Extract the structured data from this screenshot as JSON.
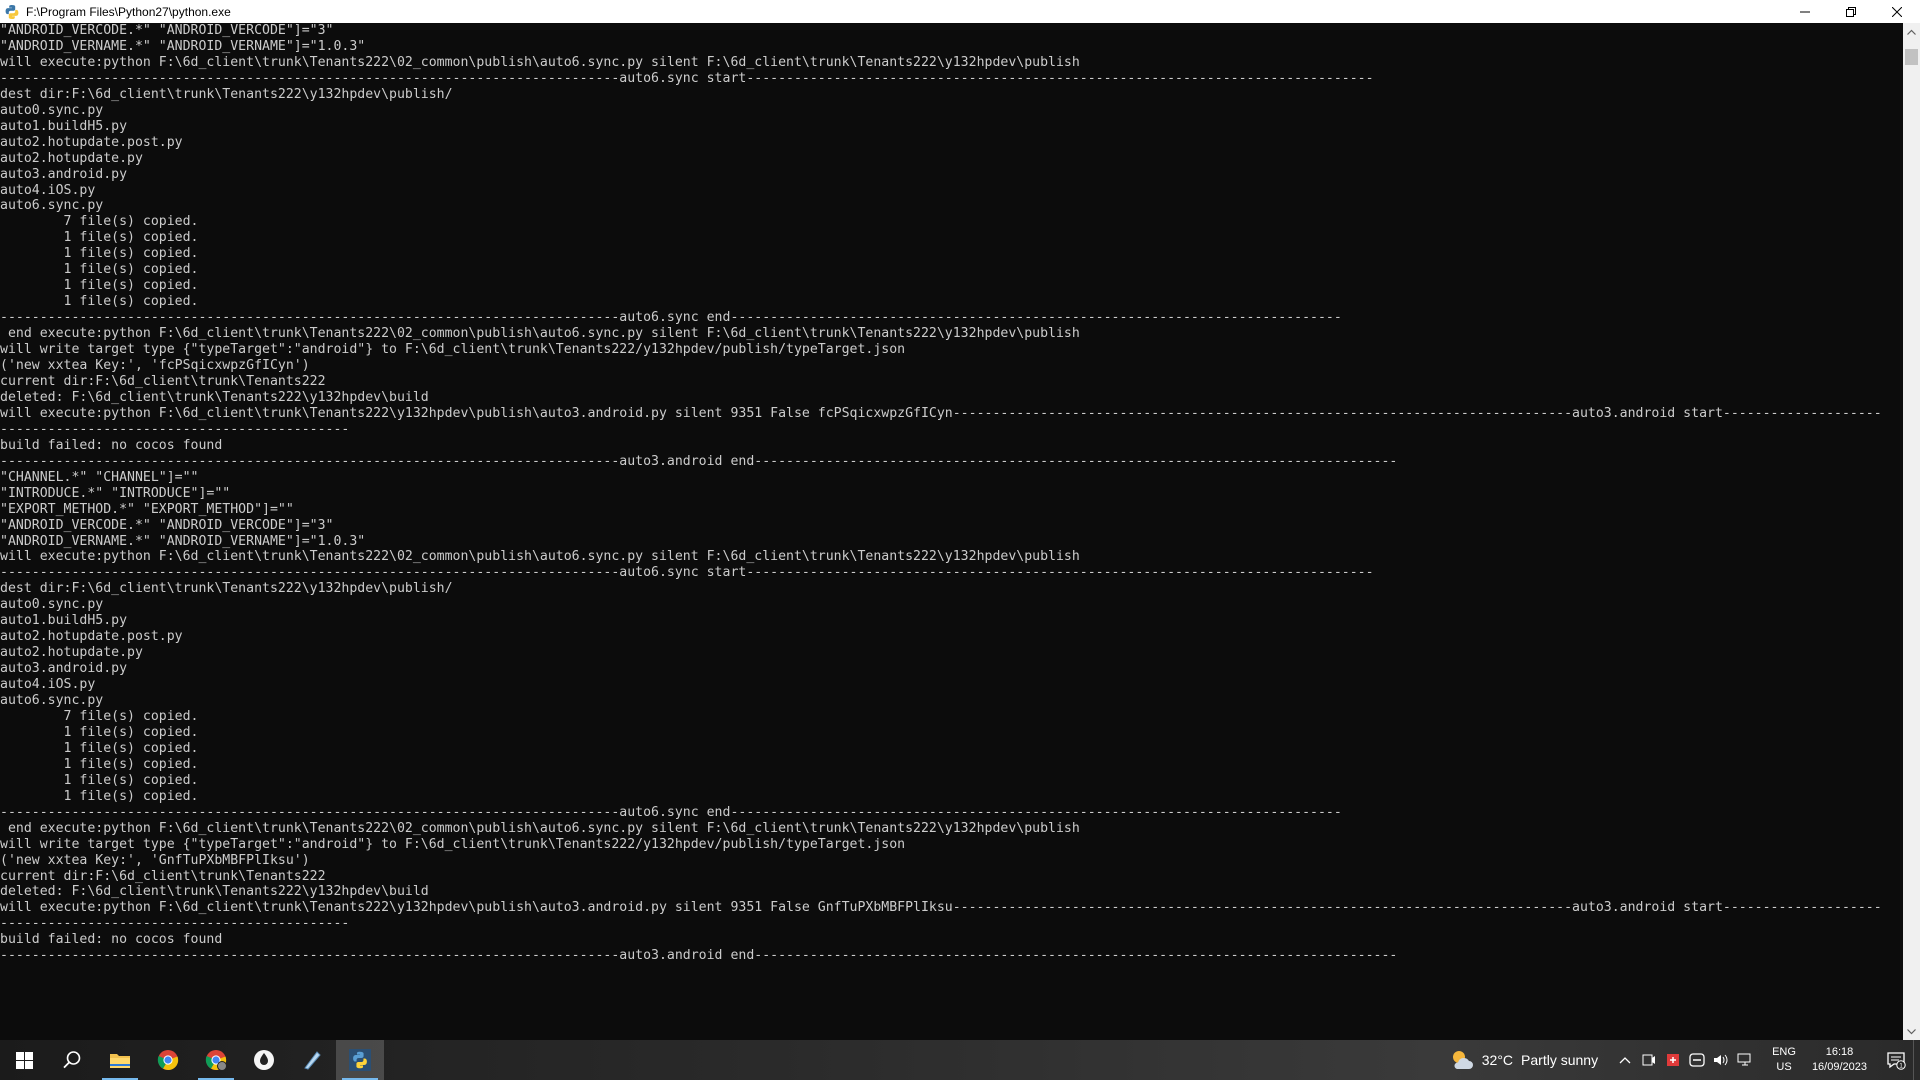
{
  "window": {
    "title": "F:\\Program Files\\Python27\\python.exe"
  },
  "console": {
    "lines": [
      "\"ANDROID_VERCODE.*\" \"ANDROID_VERCODE\"]=\"3\"",
      "\"ANDROID_VERNAME.*\" \"ANDROID_VERNAME\"]=\"1.0.3\"",
      "will execute:python F:\\6d_client\\trunk\\Tenants222\\02_common\\publish\\auto6.sync.py silent F:\\6d_client\\trunk\\Tenants222\\y132hpdev\\publish",
      "------------------------------------------------------------------------------auto6.sync start-------------------------------------------------------------------------------",
      "dest dir:F:\\6d_client\\trunk\\Tenants222\\y132hpdev\\publish/",
      "auto0.sync.py",
      "auto1.buildH5.py",
      "auto2.hotupdate.post.py",
      "auto2.hotupdate.py",
      "auto3.android.py",
      "auto4.iOS.py",
      "auto6.sync.py",
      "        7 file(s) copied.",
      "        1 file(s) copied.",
      "        1 file(s) copied.",
      "        1 file(s) copied.",
      "        1 file(s) copied.",
      "        1 file(s) copied.",
      "------------------------------------------------------------------------------auto6.sync end-----------------------------------------------------------------------------",
      " end execute:python F:\\6d_client\\trunk\\Tenants222\\02_common\\publish\\auto6.sync.py silent F:\\6d_client\\trunk\\Tenants222\\y132hpdev\\publish",
      "will write target type {\"typeTarget\":\"android\"} to F:\\6d_client\\trunk\\Tenants222/y132hpdev/publish/typeTarget.json",
      "('new xxtea Key:', 'fcPSqicxwpzGfICyn')",
      "current dir:F:\\6d_client\\trunk\\Tenants222",
      "deleted: F:\\6d_client\\trunk\\Tenants222\\y132hpdev\\build",
      "will execute:python F:\\6d_client\\trunk\\Tenants222\\y132hpdev\\publish\\auto3.android.py silent 9351 False fcPSqicxwpzGfICyn------------------------------------------------------------------------------auto3.android start--------------------",
      "--------------------------------------------",
      "build failed: no cocos found",
      "------------------------------------------------------------------------------auto3.android end---------------------------------------------------------------------------------",
      "\"CHANNEL.*\" \"CHANNEL\"]=\"\"",
      "\"INTRODUCE.*\" \"INTRODUCE\"]=\"\"",
      "\"EXPORT_METHOD.*\" \"EXPORT_METHOD\"]=\"\"",
      "\"ANDROID_VERCODE.*\" \"ANDROID_VERCODE\"]=\"3\"",
      "\"ANDROID_VERNAME.*\" \"ANDROID_VERNAME\"]=\"1.0.3\"",
      "will execute:python F:\\6d_client\\trunk\\Tenants222\\02_common\\publish\\auto6.sync.py silent F:\\6d_client\\trunk\\Tenants222\\y132hpdev\\publish",
      "------------------------------------------------------------------------------auto6.sync start-------------------------------------------------------------------------------",
      "dest dir:F:\\6d_client\\trunk\\Tenants222\\y132hpdev\\publish/",
      "auto0.sync.py",
      "auto1.buildH5.py",
      "auto2.hotupdate.post.py",
      "auto2.hotupdate.py",
      "auto3.android.py",
      "auto4.iOS.py",
      "auto6.sync.py",
      "        7 file(s) copied.",
      "        1 file(s) copied.",
      "        1 file(s) copied.",
      "        1 file(s) copied.",
      "        1 file(s) copied.",
      "        1 file(s) copied.",
      "------------------------------------------------------------------------------auto6.sync end-----------------------------------------------------------------------------",
      " end execute:python F:\\6d_client\\trunk\\Tenants222\\02_common\\publish\\auto6.sync.py silent F:\\6d_client\\trunk\\Tenants222\\y132hpdev\\publish",
      "will write target type {\"typeTarget\":\"android\"} to F:\\6d_client\\trunk\\Tenants222/y132hpdev/publish/typeTarget.json",
      "('new xxtea Key:', 'GnfTuPXbMBFPlIksu')",
      "current dir:F:\\6d_client\\trunk\\Tenants222",
      "deleted: F:\\6d_client\\trunk\\Tenants222\\y132hpdev\\build",
      "will execute:python F:\\6d_client\\trunk\\Tenants222\\y132hpdev\\publish\\auto3.android.py silent 9351 False GnfTuPXbMBFPlIksu------------------------------------------------------------------------------auto3.android start--------------------",
      "--------------------------------------------",
      "build failed: no cocos found",
      "------------------------------------------------------------------------------auto3.android end---------------------------------------------------------------------------------"
    ]
  },
  "taskbar": {
    "apps": [
      {
        "name": "file-explorer",
        "icon": "folder-icon"
      },
      {
        "name": "chrome",
        "icon": "chrome-icon"
      },
      {
        "name": "chrome-profile",
        "icon": "chrome-icon"
      },
      {
        "name": "app-drop",
        "icon": "drop-icon"
      },
      {
        "name": "app-feather",
        "icon": "feather-icon"
      },
      {
        "name": "python",
        "icon": "python-icon"
      }
    ],
    "weather": {
      "temp": "32°C",
      "condition": "Partly sunny"
    },
    "language": {
      "lang": "ENG",
      "region": "US"
    },
    "clock": {
      "time": "16:18",
      "date": "16/09/2023"
    },
    "notification_count": "1"
  },
  "colors": {
    "console_bg": "#0c0c0c",
    "console_fg": "#cccccc",
    "accent": "#76b9ed"
  }
}
